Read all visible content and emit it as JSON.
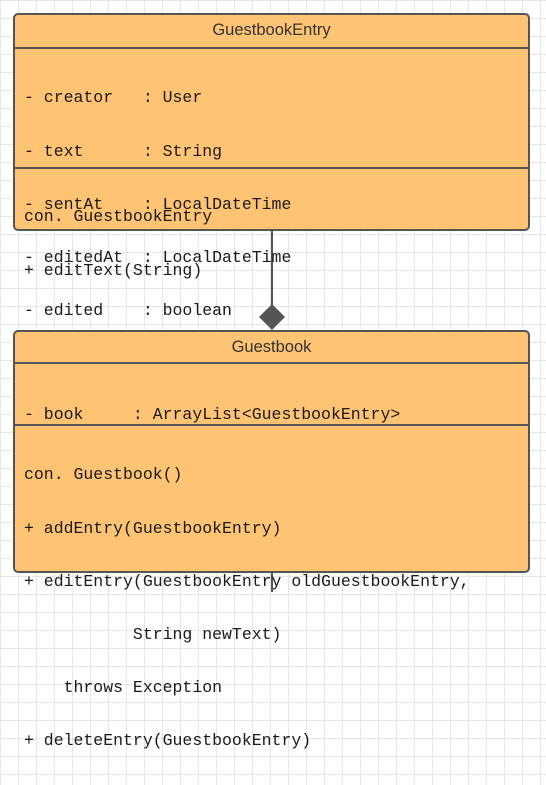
{
  "classes": {
    "entry": {
      "name": "GuestbookEntry",
      "attributes": [
        "- creator   : User",
        "- text      : String",
        "- sentAt    : LocalDateTime",
        "- editedAt  : LocalDateTime",
        "- edited    : boolean"
      ],
      "methods": [
        "con. GuestbookEntry",
        "+ editText(String)"
      ]
    },
    "guestbook": {
      "name": "Guestbook",
      "attributes": [
        "- book     : ArrayList<GuestbookEntry>"
      ],
      "methods": [
        "con. Guestbook()",
        "+ addEntry(GuestbookEntry)",
        "+ editEntry(GuestbookEntry oldGuestbookEntry,",
        "           String newText)",
        "    throws Exception",
        "+ deleteEntry(GuestbookEntry)"
      ]
    }
  },
  "colors": {
    "class_fill": "#ffc374",
    "border": "#555555"
  },
  "relationship": "composition"
}
